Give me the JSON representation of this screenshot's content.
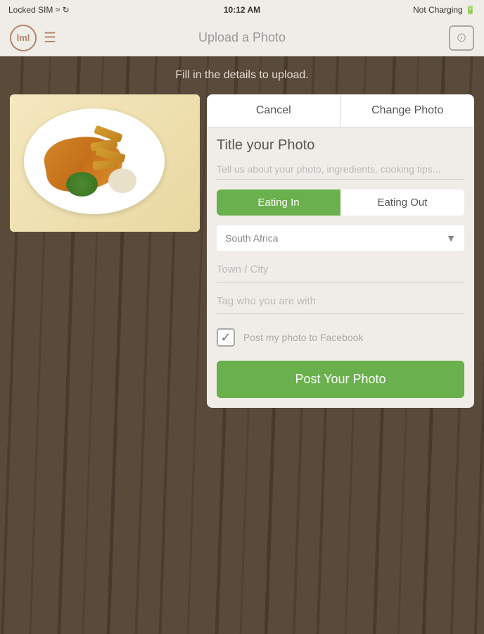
{
  "status_bar": {
    "left": "Locked SIM ≈ ↻",
    "time": "10:12 AM",
    "right": "Not Charging 🔋"
  },
  "nav": {
    "logo": "lml",
    "title": "Upload a Photo"
  },
  "subtitle": "Fill in the details to upload.",
  "form": {
    "cancel_label": "Cancel",
    "change_photo_label": "Change Photo",
    "title_placeholder": "Title your Photo",
    "description_placeholder": "Tell us about your photo, ingredients, cooking tips...",
    "eating_in_label": "Eating In",
    "eating_out_label": "Eating Out",
    "country_value": "South Africa",
    "town_placeholder": "Town / City",
    "tag_placeholder": "Tag who you are with",
    "facebook_label": "Post my photo to Facebook",
    "post_button_label": "Post Your Photo"
  },
  "colors": {
    "green": "#6ab04c",
    "brown": "#b0856a",
    "bg": "#5a4a3a"
  }
}
